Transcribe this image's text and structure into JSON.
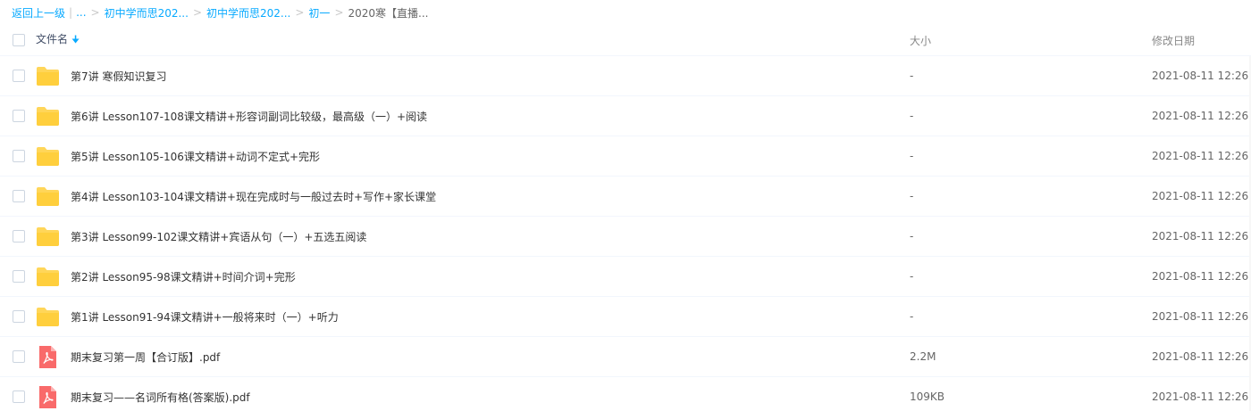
{
  "breadcrumb": {
    "back": "返回上一级",
    "ellipsis": "...",
    "items": [
      "初中学而思202...",
      "初中学而思202...",
      "初一"
    ],
    "current": "2020寒【直播..."
  },
  "header": {
    "name": "文件名",
    "size": "大小",
    "date": "修改日期"
  },
  "files": [
    {
      "type": "folder",
      "name": "第7讲 寒假知识复习",
      "size": "-",
      "date": "2021-08-11 12:26"
    },
    {
      "type": "folder",
      "name": "第6讲 Lesson107-108课文精讲+形容词副词比较级，最高级（一）+阅读",
      "size": "-",
      "date": "2021-08-11 12:26"
    },
    {
      "type": "folder",
      "name": "第5讲 Lesson105-106课文精讲+动词不定式+完形",
      "size": "-",
      "date": "2021-08-11 12:26"
    },
    {
      "type": "folder",
      "name": "第4讲 Lesson103-104课文精讲+现在完成时与一般过去时+写作+家长课堂",
      "size": "-",
      "date": "2021-08-11 12:26"
    },
    {
      "type": "folder",
      "name": "第3讲 Lesson99-102课文精讲+宾语从句（一）+五选五阅读",
      "size": "-",
      "date": "2021-08-11 12:26"
    },
    {
      "type": "folder",
      "name": "第2讲 Lesson95-98课文精讲+时间介词+完形",
      "size": "-",
      "date": "2021-08-11 12:26"
    },
    {
      "type": "folder",
      "name": "第1讲 Lesson91-94课文精讲+一般将来时（一）+听力",
      "size": "-",
      "date": "2021-08-11 12:26"
    },
    {
      "type": "pdf",
      "name": "期末复习第一周【合订版】.pdf",
      "size": "2.2M",
      "date": "2021-08-11 12:26"
    },
    {
      "type": "pdf",
      "name": "期末复习——名词所有格(答案版).pdf",
      "size": "109KB",
      "date": "2021-08-11 12:26"
    }
  ]
}
